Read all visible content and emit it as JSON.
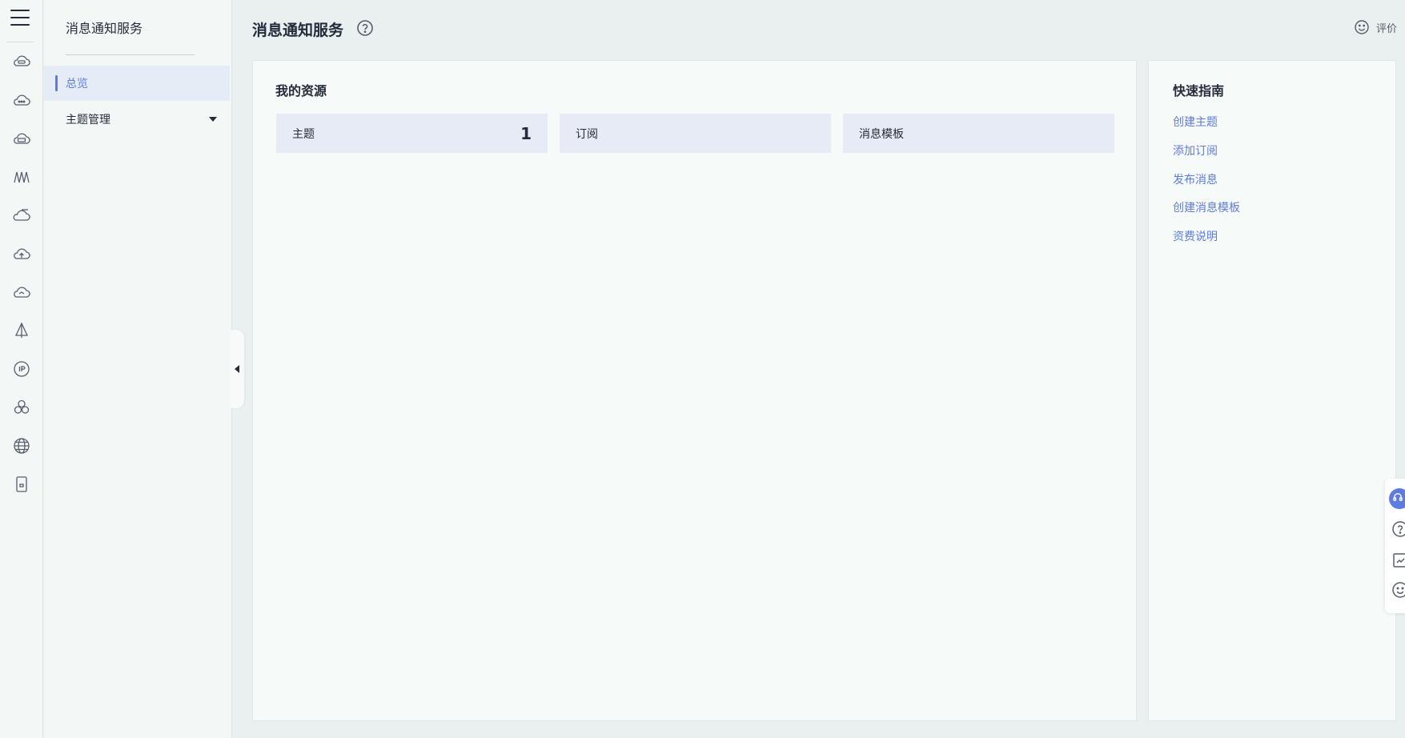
{
  "sidebar": {
    "title": "消息通知服务",
    "items": [
      {
        "label": "总览",
        "active": true
      },
      {
        "label": "主题管理",
        "expandable": true
      }
    ]
  },
  "header": {
    "title": "消息通知服务",
    "rate_label": "评价"
  },
  "resources": {
    "title": "我的资源",
    "tiles": [
      {
        "label": "主题",
        "count": "1"
      },
      {
        "label": "订阅",
        "count": ""
      },
      {
        "label": "消息模板",
        "count": ""
      }
    ]
  },
  "guide": {
    "title": "快速指南",
    "links": [
      "创建主题",
      "添加订阅",
      "发布消息",
      "创建消息模板",
      "资费说明"
    ]
  },
  "rail_icons": [
    "cloud-server-icon",
    "cloud-chat-icon",
    "cloud-db-icon",
    "wave-icon",
    "cloud-outline-icon",
    "cloud-upload-icon",
    "cloud-refresh-icon",
    "sail-icon",
    "ip-icon",
    "cluster-icon",
    "globe-icon",
    "storage-icon"
  ],
  "colors": {
    "accent": "#5e7ce0",
    "tile_bg": "#e6ebf5",
    "page_bg": "#e9f0ef"
  }
}
